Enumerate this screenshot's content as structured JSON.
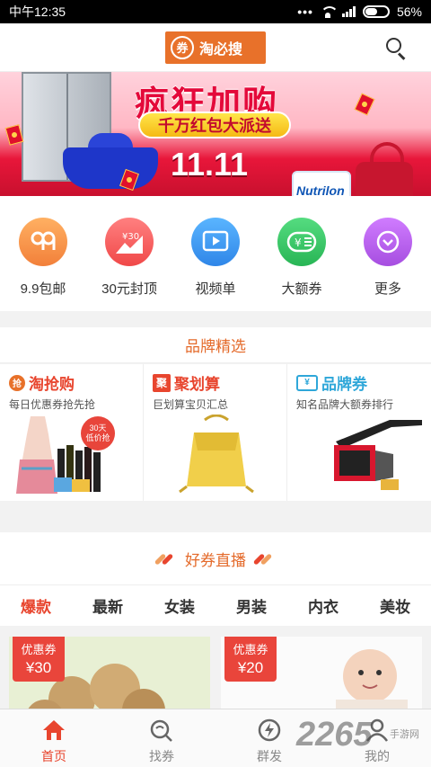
{
  "status_bar": {
    "time": "中午12:35",
    "dots": "•••",
    "battery_percent": "56%",
    "battery_level": 0.56
  },
  "header": {
    "logo_badge": "券",
    "logo_text": "淘必搜"
  },
  "banner": {
    "title": "疯狂加购",
    "pill_text": "千万红包大派送",
    "date_text": "11.11",
    "product_label": "Nutrilon"
  },
  "categories": [
    {
      "label": "9.9包邮",
      "icon": "badge-99-icon",
      "color": "#f59a43"
    },
    {
      "label": "30元封顶",
      "icon": "price-cap-icon",
      "color": "#f25a5a"
    },
    {
      "label": "视频单",
      "icon": "play-video-icon",
      "color": "#3d9af2"
    },
    {
      "label": "大额券",
      "icon": "big-coupon-icon",
      "color": "#3cc769"
    },
    {
      "label": "更多",
      "icon": "chevron-down-icon",
      "color": "#b760e8"
    }
  ],
  "brand_section": {
    "title": "品牌精选",
    "cards": [
      {
        "badge": "抢",
        "title": "淘抢购",
        "subtitle": "每日优惠券抢先抢",
        "tag": "30天\n低价抢",
        "title_color": "#e8452e"
      },
      {
        "badge": "聚",
        "title": "聚划算",
        "subtitle": "巨划算宝贝汇总",
        "title_color": "#e8452e"
      },
      {
        "badge": "¥",
        "title": "品牌券",
        "subtitle": "知名品牌大额券排行",
        "title_color": "#2fa7d9"
      }
    ]
  },
  "live_section": {
    "title": "好券直播",
    "tabs": [
      "爆款",
      "最新",
      "女装",
      "男装",
      "内衣",
      "美妆"
    ],
    "active_tab": 0,
    "products": [
      {
        "coupon_label": "优惠券",
        "coupon_value": "¥30"
      },
      {
        "coupon_label": "优惠券",
        "coupon_value": "¥20"
      }
    ]
  },
  "bottom_nav": [
    {
      "label": "首页",
      "icon": "home-icon",
      "active": true
    },
    {
      "label": "找券",
      "icon": "search-coupon-icon",
      "active": false
    },
    {
      "label": "群发",
      "icon": "broadcast-icon",
      "active": false
    },
    {
      "label": "我的",
      "icon": "user-icon",
      "active": false
    }
  ],
  "watermark": {
    "main": "2265",
    "sub": "手游网"
  },
  "colors": {
    "accent": "#e8712a",
    "active": "#e8452e",
    "banner_red": "#e4093a"
  }
}
